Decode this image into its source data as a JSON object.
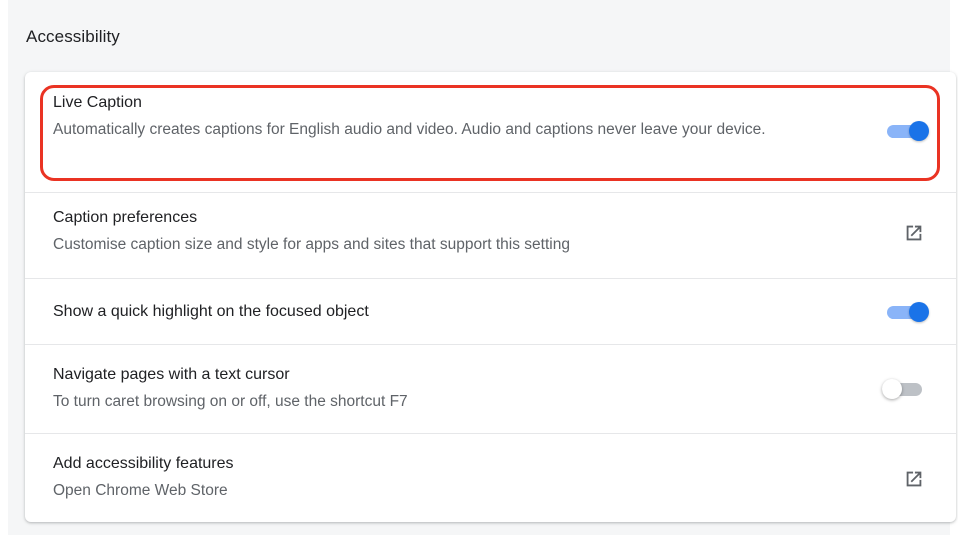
{
  "section": {
    "title": "Accessibility"
  },
  "rows": [
    {
      "title": "Live Caption",
      "description": "Automatically creates captions for English audio and video. Audio and captions never leave your device.",
      "control": "toggle",
      "enabled": true
    },
    {
      "title": "Caption preferences",
      "description": "Customise caption size and style for apps and sites that support this setting",
      "control": "external-link",
      "icon": "open-in-new-icon"
    },
    {
      "title": "Show a quick highlight on the focused object",
      "control": "toggle",
      "enabled": true
    },
    {
      "title": "Navigate pages with a text cursor",
      "description": "To turn caret browsing on or off, use the shortcut F7",
      "control": "toggle",
      "enabled": false
    },
    {
      "title": "Add accessibility features",
      "description": "Open Chrome Web Store",
      "control": "external-link",
      "icon": "open-in-new-icon"
    }
  ],
  "colors": {
    "accent": "#1a73e8",
    "accent_light": "#8ab4f8",
    "highlight": "#ea3323",
    "text_primary": "#202124",
    "text_secondary": "#5f6368"
  }
}
